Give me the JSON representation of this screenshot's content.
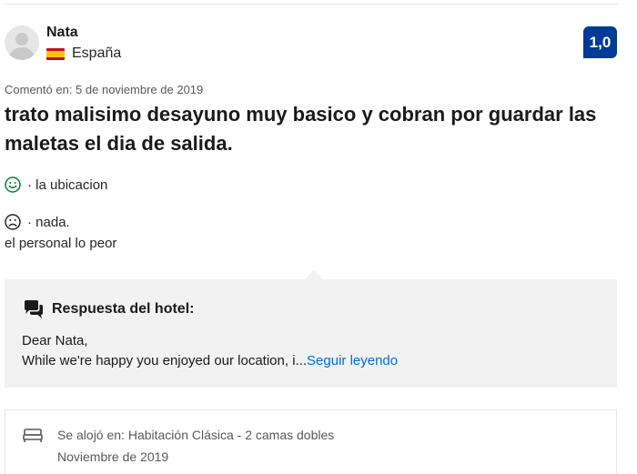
{
  "reviewer": {
    "name": "Nata",
    "country": "España",
    "flag_icon": "spain-flag-icon"
  },
  "score": "1,0",
  "review": {
    "date": "Comentó en: 5 de noviembre de 2019",
    "headline": "trato malisimo desayuno muy basico y cobran por guardar las maletas el dia de salida.",
    "positive": "· la ubicacion",
    "negative": "· nada.",
    "negative_extra": "el personal lo peor"
  },
  "hotel_reply": {
    "title": "Respuesta del hotel:",
    "line1": "Dear Nata,",
    "line2": "While we're happy you enjoyed our location, i...",
    "read_more": "Seguir leyendo"
  },
  "stay": {
    "room": "Se alojó en: Habitación Clásica - 2 camas dobles",
    "date": "Noviembre de 2019"
  },
  "colors": {
    "score_bg": "#003b95",
    "link": "#006ce4",
    "positive_face": "#008234",
    "reply_bg": "#f2f2f2"
  }
}
